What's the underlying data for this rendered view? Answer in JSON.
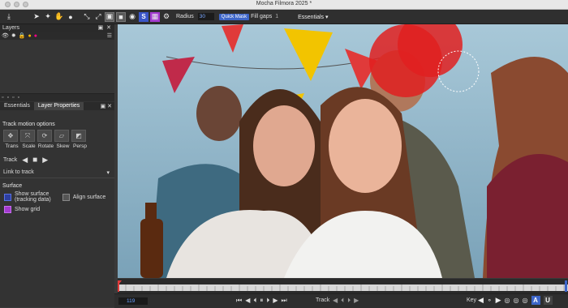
{
  "app": {
    "title": "Mocha Filmora 2025 *"
  },
  "toolbar": {
    "radius_label": "Radius",
    "radius_value": "30",
    "quick_mask_label": "Quick Mask",
    "fill_gaps_label": "Fill gaps",
    "fill_gaps_value": "1",
    "workspace_select": "Essentials"
  },
  "layers_panel": {
    "title": "Layers"
  },
  "tabs": [
    {
      "label": "Essentials"
    },
    {
      "label": "Layer Properties"
    }
  ],
  "track_motion": {
    "heading": "Track motion options",
    "options": [
      {
        "label": "Trans",
        "icon": "translate-icon"
      },
      {
        "label": "Scale",
        "icon": "scale-icon"
      },
      {
        "label": "Rotate",
        "icon": "rotate-icon"
      },
      {
        "label": "Skew",
        "icon": "skew-icon"
      },
      {
        "label": "Persp",
        "icon": "perspective-icon"
      }
    ]
  },
  "track": {
    "label": "Track"
  },
  "link_to_track": {
    "label": "Link to track"
  },
  "surface": {
    "heading": "Surface",
    "show_surface": "Show surface",
    "show_surface_sub": "(tracking data)",
    "align_surface": "Align surface",
    "show_grid": "Show grid"
  },
  "bottombar": {
    "frame": "119",
    "track_label": "Track",
    "key_label": "Key",
    "a_button": "A",
    "u_button": "U"
  },
  "colors": {
    "accent": "#3e66c9",
    "mask": "#e02020",
    "purple": "#a33ad0"
  }
}
